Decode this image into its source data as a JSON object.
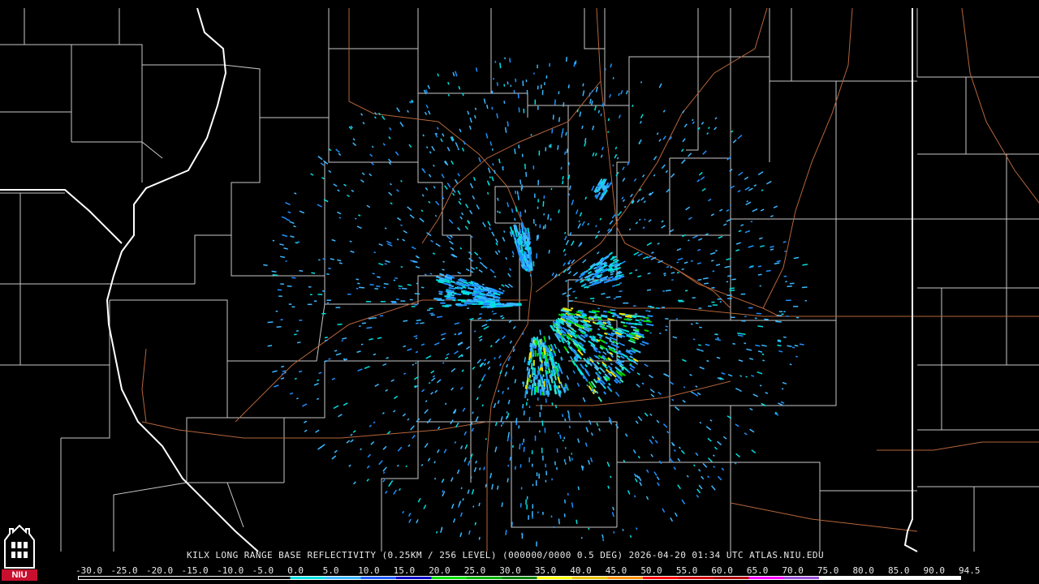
{
  "radar": {
    "caption": "KILX LONG RANGE BASE REFLECTIVITY (0.25KM / 256 LEVEL) (000000/0000 0.5 DEG) 2026-04-20 01:34 UTC  ATLAS.NIU.EDU",
    "site": "KILX",
    "product": "LONG RANGE BASE REFLECTIVITY",
    "timestamp": "2026-04-20 01:34 UTC"
  },
  "scale": {
    "labels": [
      "-30.0",
      "-25.0",
      "-20.0",
      "-15.0",
      "-10.0",
      "-5.0",
      "0.0",
      "5.0",
      "10.0",
      "15.0",
      "20.0",
      "25.0",
      "30.0",
      "35.0",
      "40.0",
      "45.0",
      "50.0",
      "55.0",
      "60.0",
      "65.0",
      "70.0",
      "75.0",
      "80.0",
      "85.0",
      "90.0",
      "94.5"
    ],
    "colors": [
      "#000000",
      "#000000",
      "#000000",
      "#000000",
      "#000000",
      "#000000",
      "#00e0e0",
      "#3cb8ff",
      "#1e5cff",
      "#0000c8",
      "#00e000",
      "#00b400",
      "#008200",
      "#ffff00",
      "#e8c000",
      "#ff9000",
      "#ff0000",
      "#d40000",
      "#b00000",
      "#ff00ff",
      "#9a50d8",
      "#ffffff",
      "#ffffff",
      "#ffffff",
      "#ffffff"
    ]
  },
  "map": {
    "county_color": "#c8c8c8",
    "state_color": "#ffffff",
    "highway_color": "#b5653a",
    "reflectivity_colors": [
      "#3cb8ff",
      "#1e90ff",
      "#00e0e0",
      "#40f0c0",
      "#00d800",
      "#e8e800"
    ]
  },
  "logo": {
    "text": "NIU"
  }
}
